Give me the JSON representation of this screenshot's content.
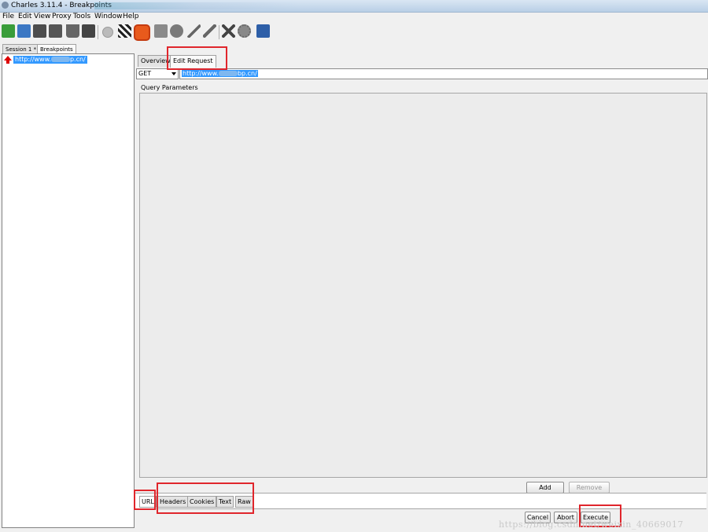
{
  "window": {
    "title": "Charles 3.11.4 - Breakpoints"
  },
  "menu": [
    "File",
    "Edit",
    "View",
    "Proxy",
    "Tools",
    "Window",
    "Help"
  ],
  "toolbar": {
    "icons": [
      "new-session-icon",
      "open-icon",
      "close-icon",
      "save-icon",
      "clear-icon",
      "find-icon",
      "record-icon",
      "throttle-icon",
      "breakpoints-icon",
      "compose-icon",
      "repeat-icon",
      "edit-icon",
      "validate-icon",
      "tools-icon",
      "settings-icon",
      "help-icon"
    ]
  },
  "session_tabs": [
    {
      "label": "Session 1 *"
    },
    {
      "label": "Breakpoints"
    }
  ],
  "tree": {
    "item_prefix": "http://www.",
    "item_suffix": "p.cn/"
  },
  "tabs": [
    {
      "label": "Overview"
    },
    {
      "label": "Edit Request"
    }
  ],
  "request": {
    "method": "GET",
    "url_prefix": "http://www.",
    "url_suffix": "bp.cn/"
  },
  "query": {
    "label": "Query Parameters",
    "add_label": "Add",
    "remove_label": "Remove"
  },
  "bottom_tabs": [
    {
      "label": "URL"
    },
    {
      "label": "Headers"
    },
    {
      "label": "Cookies"
    },
    {
      "label": "Text"
    },
    {
      "label": "Raw"
    }
  ],
  "actions": {
    "cancel_label": "Cancel",
    "abort_label": "Abort",
    "execute_label": "Execute"
  },
  "watermark": "https://blog.csdn.net/weixin_40669017",
  "colors": {
    "accent": "#3399ff",
    "highlight_box": "#e0262c",
    "breakpoint_arrow": "#dd0000"
  }
}
